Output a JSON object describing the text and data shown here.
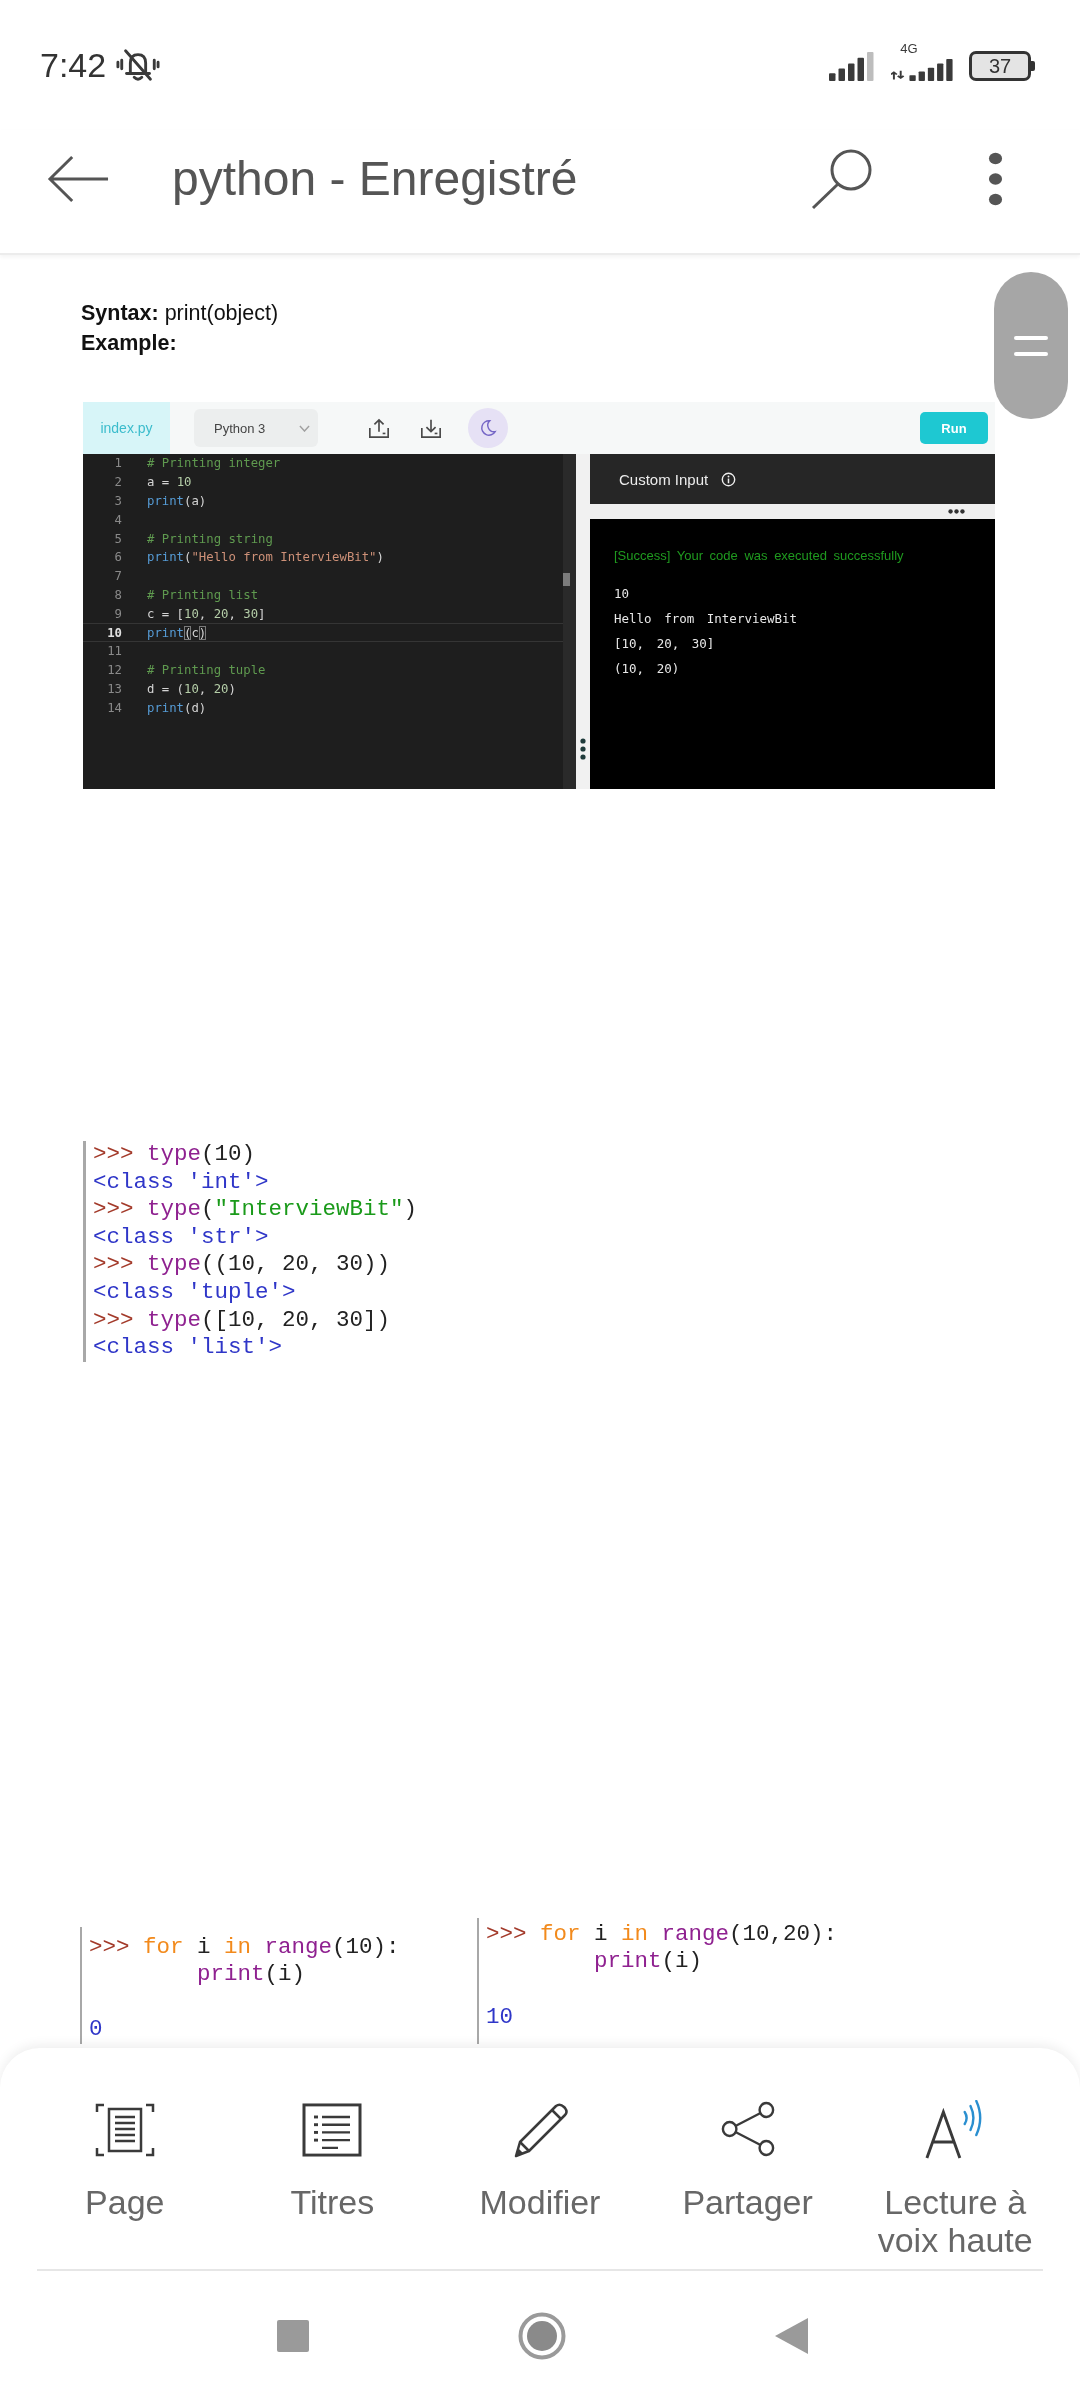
{
  "status_bar": {
    "time": "7:42",
    "network": "4G",
    "battery": "37"
  },
  "app_bar": {
    "title": "python - Enregistré"
  },
  "document": {
    "syntax_line": "**Syntax:** print(object)",
    "example_label": "Example:",
    "editor": {
      "tabs": [
        {
          "label": "index.py",
          "selected": true
        }
      ],
      "language": "Python 3",
      "run_button": "Run",
      "lines": [
        {
          "number": "1",
          "current": false,
          "tokens": [
            {
              "kind": "comment",
              "text": "# Printing integer"
            }
          ]
        },
        {
          "number": "2",
          "current": false,
          "tokens": [
            {
              "kind": "plain",
              "text": "a = "
            },
            {
              "kind": "number",
              "text": "10"
            }
          ]
        },
        {
          "number": "3",
          "current": false,
          "tokens": [
            {
              "kind": "builtin",
              "text": "print"
            },
            {
              "kind": "plain",
              "text": "(a)"
            }
          ]
        },
        {
          "number": "4",
          "current": false
        },
        {
          "number": "5",
          "current": false,
          "tokens": [
            {
              "kind": "comment",
              "text": "# Printing string"
            }
          ]
        },
        {
          "number": "6",
          "current": false,
          "tokens": [
            {
              "kind": "builtin",
              "text": "print"
            },
            {
              "kind": "plain",
              "text": "("
            },
            {
              "kind": "string",
              "text": "\"Hello from InterviewBit\""
            },
            {
              "kind": "plain",
              "text": ")"
            }
          ]
        },
        {
          "number": "7",
          "current": false
        },
        {
          "number": "8",
          "current": false,
          "tokens": [
            {
              "kind": "comment",
              "text": "# Printing list"
            }
          ]
        },
        {
          "number": "9",
          "current": false,
          "tokens": [
            {
              "kind": "plain",
              "text": "c = ["
            },
            {
              "kind": "number",
              "text": "10"
            },
            {
              "kind": "plain",
              "text": ", "
            },
            {
              "kind": "number",
              "text": "20"
            },
            {
              "kind": "plain",
              "text": ", "
            },
            {
              "kind": "number",
              "text": "30"
            },
            {
              "kind": "plain",
              "text": "]"
            }
          ]
        },
        {
          "number": "10",
          "current": true,
          "tokens": [
            {
              "kind": "builtin",
              "text": "print"
            },
            {
              "kind": "bracket_match",
              "text": "("
            },
            {
              "kind": "plain",
              "text": "c"
            },
            {
              "kind": "bracket_match",
              "text": ")"
            }
          ]
        },
        {
          "number": "11",
          "current": false
        },
        {
          "number": "12",
          "current": false,
          "tokens": [
            {
              "kind": "comment",
              "text": "# Printing tuple"
            }
          ]
        },
        {
          "number": "13",
          "current": false,
          "tokens": [
            {
              "kind": "plain",
              "text": "d = ("
            },
            {
              "kind": "number",
              "text": "10"
            },
            {
              "kind": "plain",
              "text": ", "
            },
            {
              "kind": "number",
              "text": "20"
            },
            {
              "kind": "plain",
              "text": ")"
            }
          ]
        },
        {
          "number": "14",
          "current": false,
          "tokens": [
            {
              "kind": "builtin",
              "text": "print"
            },
            {
              "kind": "plain",
              "text": "(d)"
            }
          ]
        }
      ],
      "custom_input": {
        "label": "Custom Input"
      },
      "output": {
        "status": "[Success] Your code was executed successfully",
        "lines": [
          "10",
          "Hello from InterviewBit",
          "[10, 20, 30]",
          "(10, 20)"
        ]
      }
    },
    "shell_session": {
      "lines": [
        {
          "kind": "input",
          "tokens": [
            {
              "kind": "prompt",
              "text": ">>> "
            },
            {
              "kind": "builtin",
              "text": "type"
            },
            {
              "kind": "plain",
              "text": "(10)"
            }
          ]
        },
        {
          "kind": "output",
          "text": "<class 'int'>"
        },
        {
          "kind": "input",
          "tokens": [
            {
              "kind": "prompt",
              "text": ">>> "
            },
            {
              "kind": "builtin",
              "text": "type"
            },
            {
              "kind": "plain",
              "text": "("
            },
            {
              "kind": "string",
              "text": "\"InterviewBit\""
            },
            {
              "kind": "plain",
              "text": ")"
            }
          ]
        },
        {
          "kind": "output",
          "text": "<class 'str'>"
        },
        {
          "kind": "input",
          "tokens": [
            {
              "kind": "prompt",
              "text": ">>> "
            },
            {
              "kind": "builtin",
              "text": "type"
            },
            {
              "kind": "plain",
              "text": "((10, 20, 30))"
            }
          ]
        },
        {
          "kind": "output",
          "text": "<class 'tuple'>"
        },
        {
          "kind": "input",
          "tokens": [
            {
              "kind": "prompt",
              "text": ">>> "
            },
            {
              "kind": "builtin",
              "text": "type"
            },
            {
              "kind": "plain",
              "text": "([10, 20, 30])"
            }
          ]
        },
        {
          "kind": "output",
          "text": "<class 'list'>"
        }
      ]
    },
    "loop_examples": [
      {
        "lines": [
          {
            "kind": "input",
            "tokens": [
              {
                "kind": "prompt",
                "text": ">>> "
              },
              {
                "kind": "keyword",
                "text": "for"
              },
              {
                "kind": "plain",
                "text": " i "
              },
              {
                "kind": "keyword",
                "text": "in "
              },
              {
                "kind": "builtin",
                "text": "range"
              },
              {
                "kind": "plain",
                "text": "(10):"
              }
            ]
          },
          {
            "kind": "continuation",
            "tokens": [
              {
                "kind": "builtin",
                "text": "print"
              },
              {
                "kind": "plain",
                "text": "(i)"
              }
            ]
          },
          {
            "kind": "blank"
          },
          {
            "kind": "output",
            "text": "0"
          }
        ]
      },
      {
        "lines": [
          {
            "kind": "input",
            "tokens": [
              {
                "kind": "prompt",
                "text": ">>> "
              },
              {
                "kind": "keyword",
                "text": "for"
              },
              {
                "kind": "plain",
                "text": " i "
              },
              {
                "kind": "keyword",
                "text": "in "
              },
              {
                "kind": "builtin",
                "text": "range"
              },
              {
                "kind": "plain",
                "text": "(10,20):"
              }
            ]
          },
          {
            "kind": "continuation",
            "tokens": [
              {
                "kind": "builtin",
                "text": "print"
              },
              {
                "kind": "plain",
                "text": "(i)"
              }
            ]
          },
          {
            "kind": "blank"
          },
          {
            "kind": "output",
            "text": "10"
          }
        ]
      }
    ]
  },
  "bottom_sheet": {
    "actions": [
      {
        "kind": "page",
        "label": "Page"
      },
      {
        "kind": "headings",
        "label": "Titres"
      },
      {
        "kind": "edit",
        "label": "Modifier"
      },
      {
        "kind": "share",
        "label": "Partager"
      },
      {
        "kind": "read_aloud",
        "label": "Lecture à voix haute"
      }
    ]
  }
}
